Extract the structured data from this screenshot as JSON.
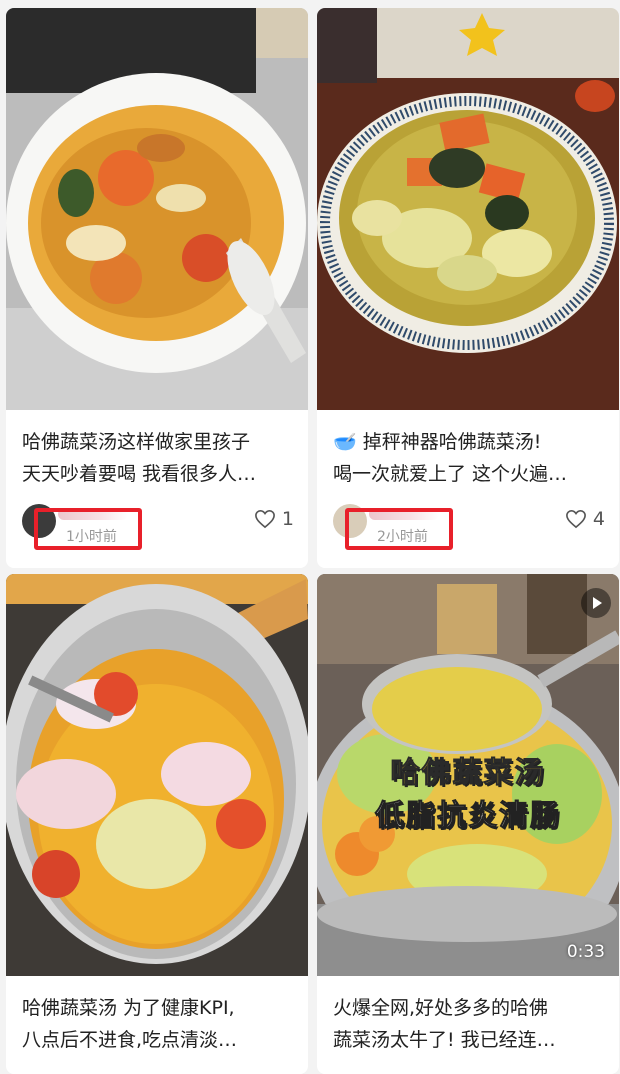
{
  "feed": {
    "cards": [
      {
        "title_line1": "哈佛蔬菜汤这样做家里孩子",
        "title_line2": "天天吵着要喝 我看很多人…",
        "time": "1小时前",
        "likes": "1",
        "thumbnail_icon": "soup-bowl-photo"
      },
      {
        "title_emoji": "🥣",
        "title_line1": "掉秤神器哈佛蔬菜汤!",
        "title_line2": "喝一次就爱上了 这个火遍…",
        "time": "2小时前",
        "likes": "4",
        "thumbnail_icon": "soup-bowl-photo"
      },
      {
        "title_line1": "哈佛蔬菜汤 为了健康KPI,",
        "title_line2": "八点后不进食,吃点清淡…",
        "thumbnail_icon": "soup-pot-photo"
      },
      {
        "title_line1": "火爆全网,好处多多的哈佛",
        "title_line2": "蔬菜汤太牛了! 我已经连…",
        "overlay_line1": "哈佛蔬菜汤",
        "overlay_line2": "低脂抗炎清肠",
        "duration": "0:33",
        "thumbnail_icon": "video-soup-pot-photo"
      }
    ]
  },
  "colors": {
    "highlight_box": "#e8202a",
    "overlay_yellow": "#ffd21f",
    "background": "#f3f3f3"
  }
}
